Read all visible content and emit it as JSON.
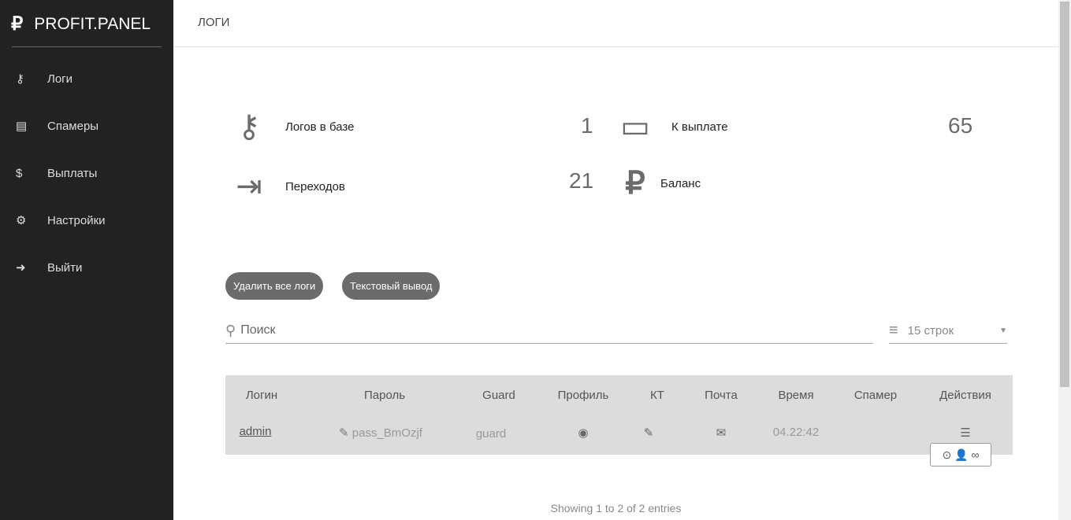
{
  "brand": {
    "icon": "ruble-icon",
    "name": "PROFIT.PANEL"
  },
  "nav": [
    {
      "label": "Логи",
      "icon": "key-icon"
    },
    {
      "label": "Спамеры",
      "icon": "id-card-icon"
    },
    {
      "label": "Выплаты",
      "icon": "hand-dollar-icon"
    },
    {
      "label": "Настройки",
      "icon": "gear-icon"
    },
    {
      "label": "Выйти",
      "icon": "sign-out-icon"
    }
  ],
  "header": {
    "title": "ЛОГИ"
  },
  "stats": {
    "logs": {
      "label": "Логов в базе",
      "value": "1"
    },
    "payout": {
      "label": "К выплате",
      "value": "65"
    },
    "clicks": {
      "label": "Переходов",
      "value": "21"
    },
    "balance": {
      "label": "Баланс",
      "value": ""
    }
  },
  "buttons": {
    "delete_all": "Удалить все логи",
    "text_output": "Текстовый вывод"
  },
  "search": {
    "placeholder": "Поиск"
  },
  "rows_select": {
    "value": "15 строк"
  },
  "table": {
    "headers": [
      "Логин",
      "Пароль",
      "Guard",
      "Профиль",
      "КТ",
      "Почта",
      "Время",
      "Спамер",
      "Действия"
    ],
    "rows": [
      {
        "login": "admin",
        "password": "pass_BmOzjf",
        "guard": "guard",
        "time": "04.22:42",
        "spammer": ""
      }
    ]
  },
  "footer": {
    "info": "Showing 1 to 2 of 2 entries"
  }
}
